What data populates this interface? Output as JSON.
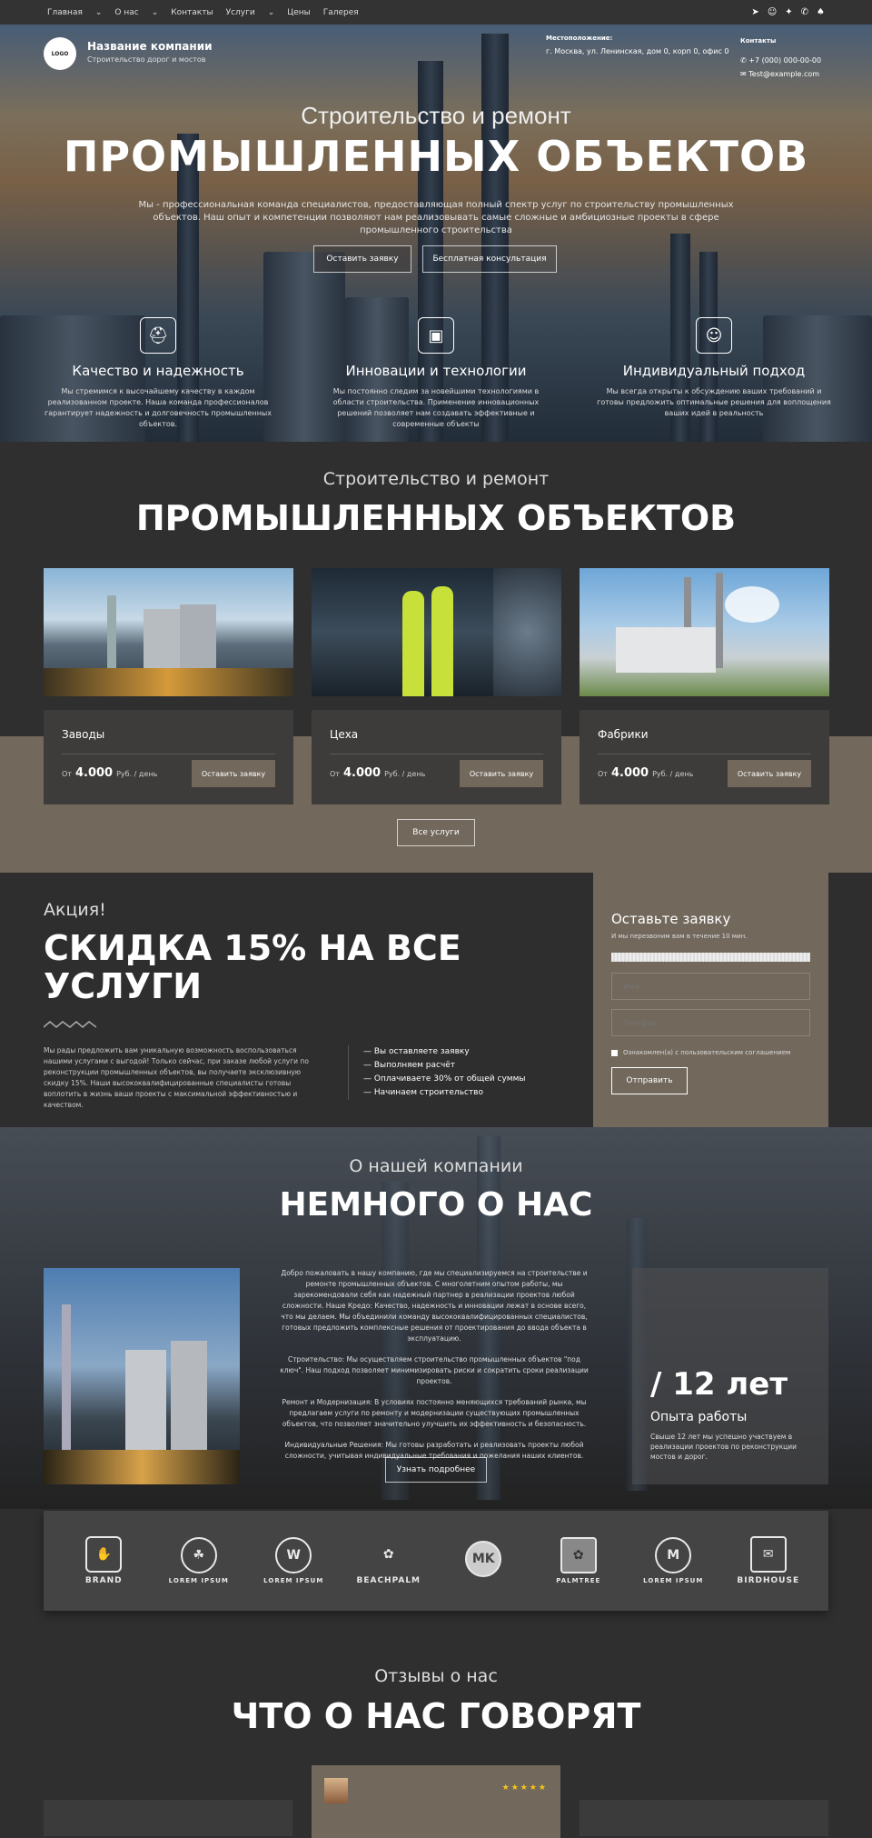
{
  "topbar": {
    "menu": [
      "Главная",
      "О нас",
      "Контакты",
      "Услуги",
      "Цены",
      "Галерея"
    ],
    "social_icons": [
      "telegram-icon",
      "odnoklassniki-icon",
      "twitter-icon",
      "whatsapp-icon",
      "snapchat-icon"
    ]
  },
  "header": {
    "logo_text": "LOGO",
    "company_name": "Название компании",
    "company_tagline": "Строительство дорог и мостов",
    "location_label": "Местоположение:",
    "location_value": "г. Москва, ул. Ленинская, дом 0, корп 0, офис 0",
    "contacts_label": "Контакты",
    "phone": "+7 (000) 000-00-00",
    "email": "Test@example.com"
  },
  "hero": {
    "subtitle": "Строительство и ремонт",
    "title": "ПРОМЫШЛЕННЫХ ОБЪЕКТОВ",
    "description": "Мы - профессиональная команда специалистов, предоставляющая полный спектр услуг по строительству промышленных объектов. Наш опыт и компетенции позволяют нам реализовывать самые сложные и амбициозные проекты в сфере промышленного строительства",
    "btn_primary": "Оставить заявку",
    "btn_secondary": "Бесплатная консультация",
    "features": [
      {
        "icon": "engineer-icon",
        "title": "Качество и надежность",
        "text": "Мы стремимся к высочайшему качеству в каждом реализованном проекте. Наша команда профессионалов гарантирует надежность и долговечность промышленных объектов."
      },
      {
        "icon": "chip-icon",
        "title": "Инновации и технологии",
        "text": "Мы постоянно следим за новейшими технологиями в области строительства. Применение инновационных решений позволяет нам создавать эффективные и современные объекты"
      },
      {
        "icon": "worker-icon",
        "title": "Индивидуальный подход",
        "text": "Мы всегда открыты к обсуждению ваших требований и готовы предложить оптимальные решения для воплощения ваших идей в реальность"
      }
    ]
  },
  "services": {
    "subtitle": "Строительство и ремонт",
    "title": "ПРОМЫШЛЕННЫХ ОБЪЕКТОВ",
    "cards": [
      {
        "title": "Заводы",
        "from": "От",
        "price": "4.000",
        "unit": "Руб. / день",
        "button": "Оставить заявку"
      },
      {
        "title": "Цеха",
        "from": "От",
        "price": "4.000",
        "unit": "Руб. / день",
        "button": "Оставить заявку"
      },
      {
        "title": "Фабрики",
        "from": "От",
        "price": "4.000",
        "unit": "Руб. / день",
        "button": "Оставить заявку"
      }
    ],
    "all_button": "Все услуги"
  },
  "promo": {
    "label": "Акция!",
    "title_line1": "СКИДКА 15% НА ВСЕ",
    "title_line2": "УСЛУГИ",
    "text": "Мы рады предложить вам уникальную возможность воспользоваться нашими услугами с выгодой! Только сейчас, при заказе любой услуги по реконструкции промышленных объектов, вы получаете эксклюзивную скидку 15%. Наши высококвалифицированные специалисты готовы воплотить в жизнь ваши проекты с максимальной эффективностью и качеством.",
    "steps": [
      "— Вы оставляете заявку",
      "— Выполняем расчёт",
      "— Оплачиваете 30% от общей суммы",
      "— Начинаем строительство"
    ]
  },
  "form": {
    "title": "Оставьте заявку",
    "subtitle": "И мы перезвоним вам в течение 10 мин.",
    "name_placeholder": "Имя:",
    "phone_placeholder": "Телефон:",
    "consent": "Ознакомлен(а) с пользовательским соглашением",
    "submit": "Отправить"
  },
  "about": {
    "subtitle": "О нашей компании",
    "title": "НЕМНОГО О НАС",
    "paragraphs": [
      "Добро пожаловать в нашу компанию, где мы специализируемся на строительстве и ремонте промышленных объектов. С многолетним опытом работы, мы зарекомендовали себя как надежный партнер в реализации проектов любой сложности. Наше Кредо: Качество, надежность и инновации лежат в основе всего, что мы делаем. Мы объединили команду высококвалифицированных специалистов, готовых предложить комплексные решения от проектирования до ввода объекта в эксплуатацию.",
      "Строительство: Мы осуществляем строительство промышленных объектов \"под ключ\". Наш подход позволяет минимизировать риски и сократить сроки реализации проектов.",
      "Ремонт и Модернизация: В условиях постоянно меняющихся требований рынка, мы предлагаем услуги по ремонту и модернизации существующих промышленных объектов, что позволяет значительно улучшить их эффективность и безопасность.",
      "Индивидуальные Решения: Мы готовы разработать и реализовать проекты любой сложности, учитывая индивидуальные требования и пожелания наших клиентов."
    ],
    "more_button": "Узнать подробнее",
    "years": "/ 12 лет",
    "years_label": "Опыта работы",
    "years_text": "Свыше 12 лет мы успешно участвуем в реализации проектов по реконструкции мостов и дорог."
  },
  "partners": [
    {
      "mark": "✋",
      "name": "BRAND"
    },
    {
      "mark": "☘",
      "name": "LOREM IPSUM"
    },
    {
      "mark": "W",
      "name": "LOREM IPSUM"
    },
    {
      "mark": "✿",
      "name": "BEACHPALM"
    },
    {
      "mark": "MK",
      "name": ""
    },
    {
      "mark": "✿",
      "name": "PALMTREE"
    },
    {
      "mark": "M",
      "name": "LOREM IPSUM"
    },
    {
      "mark": "✉",
      "name": "BIRDHOUSE"
    }
  ],
  "reviews": {
    "subtitle": "Отзывы о нас",
    "title": "ЧТО О НАС ГОВОРЯТ",
    "stars": "★★★★★"
  }
}
